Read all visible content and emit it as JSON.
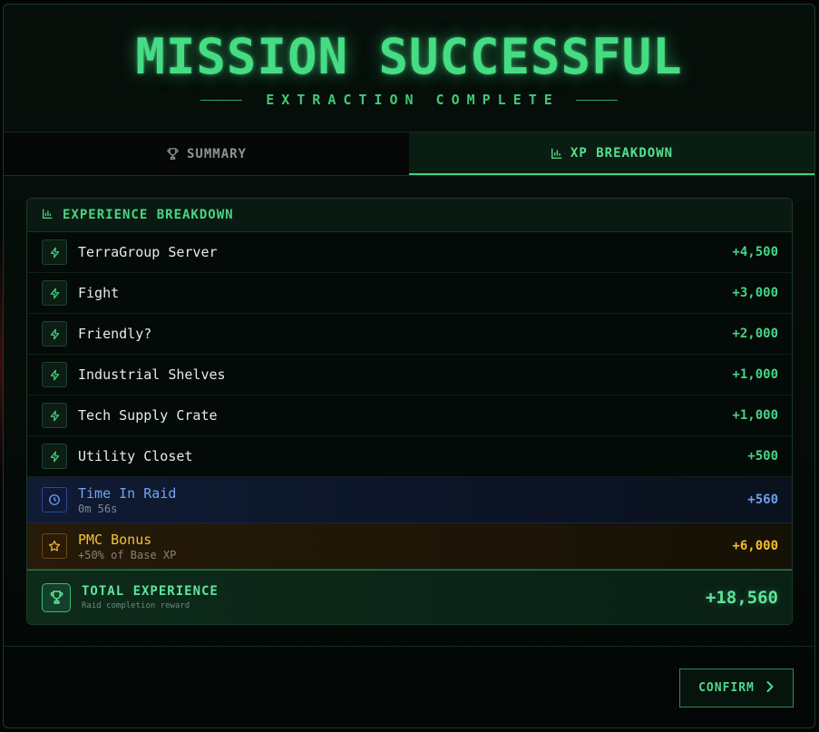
{
  "header": {
    "title": "MISSION SUCCESSFUL",
    "subtitle": "EXTRACTION COMPLETE"
  },
  "tabs": [
    {
      "label": "SUMMARY",
      "icon": "trophy-icon",
      "active": false
    },
    {
      "label": "XP BREAKDOWN",
      "icon": "bar-chart-icon",
      "active": true
    }
  ],
  "breakdown": {
    "heading": "EXPERIENCE BREAKDOWN",
    "items": [
      {
        "label": "TerraGroup Server",
        "value": "+4,500",
        "icon": "lightning-icon"
      },
      {
        "label": "Fight",
        "value": "+3,000",
        "icon": "lightning-icon"
      },
      {
        "label": "Friendly?",
        "value": "+2,000",
        "icon": "lightning-icon"
      },
      {
        "label": "Industrial Shelves",
        "value": "+1,000",
        "icon": "lightning-icon"
      },
      {
        "label": "Tech Supply Crate",
        "value": "+1,000",
        "icon": "lightning-icon"
      },
      {
        "label": "Utility Closet",
        "value": "+500",
        "icon": "lightning-icon"
      }
    ],
    "time_in_raid": {
      "label": "Time In Raid",
      "sub": "0m 56s",
      "value": "+560",
      "icon": "clock-icon"
    },
    "pmc_bonus": {
      "label": "PMC Bonus",
      "sub": "+50% of Base XP",
      "value": "+6,000",
      "icon": "star-icon"
    },
    "total": {
      "label": "TOTAL EXPERIENCE",
      "sub": "Raid completion reward",
      "value": "+18,560",
      "icon": "trophy-icon"
    }
  },
  "footer": {
    "confirm_label": "CONFIRM"
  },
  "colors": {
    "accent": "#46dc84",
    "time": "#6d9ff0",
    "bonus": "#f5bf2c"
  }
}
